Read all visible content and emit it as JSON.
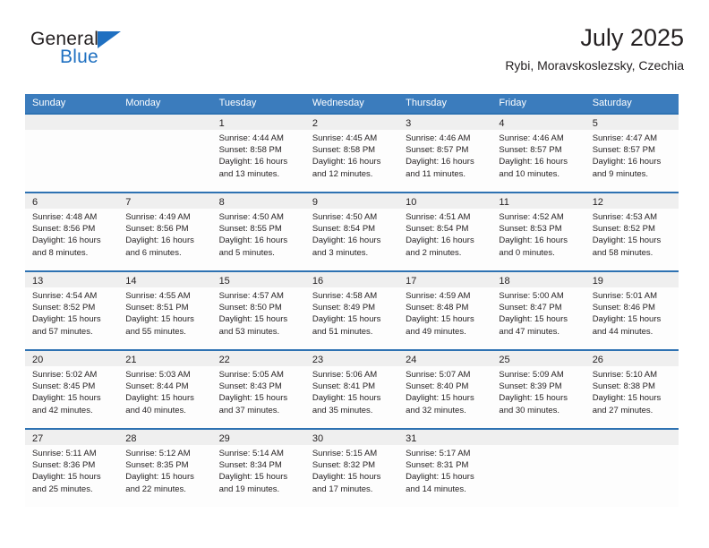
{
  "logo": {
    "line1": "General",
    "line2": "Blue",
    "accent_color": "#1F70C1",
    "text_color": "#231F20"
  },
  "header": {
    "title": "July 2025",
    "subtitle": "Rybi, Moravskoslezsky, Czechia"
  },
  "colors": {
    "header_blue": "#3B7CBD",
    "row_rule_blue": "#2E72B2",
    "day_band_gray": "#EFEFEF",
    "cell_white": "#FDFDFD"
  },
  "weekdays": [
    "Sunday",
    "Monday",
    "Tuesday",
    "Wednesday",
    "Thursday",
    "Friday",
    "Saturday"
  ],
  "weeks": [
    [
      {
        "day": "",
        "sunrise": "",
        "sunset": "",
        "daylight1": "",
        "daylight2": ""
      },
      {
        "day": "",
        "sunrise": "",
        "sunset": "",
        "daylight1": "",
        "daylight2": ""
      },
      {
        "day": "1",
        "sunrise": "Sunrise: 4:44 AM",
        "sunset": "Sunset: 8:58 PM",
        "daylight1": "Daylight: 16 hours",
        "daylight2": "and 13 minutes."
      },
      {
        "day": "2",
        "sunrise": "Sunrise: 4:45 AM",
        "sunset": "Sunset: 8:58 PM",
        "daylight1": "Daylight: 16 hours",
        "daylight2": "and 12 minutes."
      },
      {
        "day": "3",
        "sunrise": "Sunrise: 4:46 AM",
        "sunset": "Sunset: 8:57 PM",
        "daylight1": "Daylight: 16 hours",
        "daylight2": "and 11 minutes."
      },
      {
        "day": "4",
        "sunrise": "Sunrise: 4:46 AM",
        "sunset": "Sunset: 8:57 PM",
        "daylight1": "Daylight: 16 hours",
        "daylight2": "and 10 minutes."
      },
      {
        "day": "5",
        "sunrise": "Sunrise: 4:47 AM",
        "sunset": "Sunset: 8:57 PM",
        "daylight1": "Daylight: 16 hours",
        "daylight2": "and 9 minutes."
      }
    ],
    [
      {
        "day": "6",
        "sunrise": "Sunrise: 4:48 AM",
        "sunset": "Sunset: 8:56 PM",
        "daylight1": "Daylight: 16 hours",
        "daylight2": "and 8 minutes."
      },
      {
        "day": "7",
        "sunrise": "Sunrise: 4:49 AM",
        "sunset": "Sunset: 8:56 PM",
        "daylight1": "Daylight: 16 hours",
        "daylight2": "and 6 minutes."
      },
      {
        "day": "8",
        "sunrise": "Sunrise: 4:50 AM",
        "sunset": "Sunset: 8:55 PM",
        "daylight1": "Daylight: 16 hours",
        "daylight2": "and 5 minutes."
      },
      {
        "day": "9",
        "sunrise": "Sunrise: 4:50 AM",
        "sunset": "Sunset: 8:54 PM",
        "daylight1": "Daylight: 16 hours",
        "daylight2": "and 3 minutes."
      },
      {
        "day": "10",
        "sunrise": "Sunrise: 4:51 AM",
        "sunset": "Sunset: 8:54 PM",
        "daylight1": "Daylight: 16 hours",
        "daylight2": "and 2 minutes."
      },
      {
        "day": "11",
        "sunrise": "Sunrise: 4:52 AM",
        "sunset": "Sunset: 8:53 PM",
        "daylight1": "Daylight: 16 hours",
        "daylight2": "and 0 minutes."
      },
      {
        "day": "12",
        "sunrise": "Sunrise: 4:53 AM",
        "sunset": "Sunset: 8:52 PM",
        "daylight1": "Daylight: 15 hours",
        "daylight2": "and 58 minutes."
      }
    ],
    [
      {
        "day": "13",
        "sunrise": "Sunrise: 4:54 AM",
        "sunset": "Sunset: 8:52 PM",
        "daylight1": "Daylight: 15 hours",
        "daylight2": "and 57 minutes."
      },
      {
        "day": "14",
        "sunrise": "Sunrise: 4:55 AM",
        "sunset": "Sunset: 8:51 PM",
        "daylight1": "Daylight: 15 hours",
        "daylight2": "and 55 minutes."
      },
      {
        "day": "15",
        "sunrise": "Sunrise: 4:57 AM",
        "sunset": "Sunset: 8:50 PM",
        "daylight1": "Daylight: 15 hours",
        "daylight2": "and 53 minutes."
      },
      {
        "day": "16",
        "sunrise": "Sunrise: 4:58 AM",
        "sunset": "Sunset: 8:49 PM",
        "daylight1": "Daylight: 15 hours",
        "daylight2": "and 51 minutes."
      },
      {
        "day": "17",
        "sunrise": "Sunrise: 4:59 AM",
        "sunset": "Sunset: 8:48 PM",
        "daylight1": "Daylight: 15 hours",
        "daylight2": "and 49 minutes."
      },
      {
        "day": "18",
        "sunrise": "Sunrise: 5:00 AM",
        "sunset": "Sunset: 8:47 PM",
        "daylight1": "Daylight: 15 hours",
        "daylight2": "and 47 minutes."
      },
      {
        "day": "19",
        "sunrise": "Sunrise: 5:01 AM",
        "sunset": "Sunset: 8:46 PM",
        "daylight1": "Daylight: 15 hours",
        "daylight2": "and 44 minutes."
      }
    ],
    [
      {
        "day": "20",
        "sunrise": "Sunrise: 5:02 AM",
        "sunset": "Sunset: 8:45 PM",
        "daylight1": "Daylight: 15 hours",
        "daylight2": "and 42 minutes."
      },
      {
        "day": "21",
        "sunrise": "Sunrise: 5:03 AM",
        "sunset": "Sunset: 8:44 PM",
        "daylight1": "Daylight: 15 hours",
        "daylight2": "and 40 minutes."
      },
      {
        "day": "22",
        "sunrise": "Sunrise: 5:05 AM",
        "sunset": "Sunset: 8:43 PM",
        "daylight1": "Daylight: 15 hours",
        "daylight2": "and 37 minutes."
      },
      {
        "day": "23",
        "sunrise": "Sunrise: 5:06 AM",
        "sunset": "Sunset: 8:41 PM",
        "daylight1": "Daylight: 15 hours",
        "daylight2": "and 35 minutes."
      },
      {
        "day": "24",
        "sunrise": "Sunrise: 5:07 AM",
        "sunset": "Sunset: 8:40 PM",
        "daylight1": "Daylight: 15 hours",
        "daylight2": "and 32 minutes."
      },
      {
        "day": "25",
        "sunrise": "Sunrise: 5:09 AM",
        "sunset": "Sunset: 8:39 PM",
        "daylight1": "Daylight: 15 hours",
        "daylight2": "and 30 minutes."
      },
      {
        "day": "26",
        "sunrise": "Sunrise: 5:10 AM",
        "sunset": "Sunset: 8:38 PM",
        "daylight1": "Daylight: 15 hours",
        "daylight2": "and 27 minutes."
      }
    ],
    [
      {
        "day": "27",
        "sunrise": "Sunrise: 5:11 AM",
        "sunset": "Sunset: 8:36 PM",
        "daylight1": "Daylight: 15 hours",
        "daylight2": "and 25 minutes."
      },
      {
        "day": "28",
        "sunrise": "Sunrise: 5:12 AM",
        "sunset": "Sunset: 8:35 PM",
        "daylight1": "Daylight: 15 hours",
        "daylight2": "and 22 minutes."
      },
      {
        "day": "29",
        "sunrise": "Sunrise: 5:14 AM",
        "sunset": "Sunset: 8:34 PM",
        "daylight1": "Daylight: 15 hours",
        "daylight2": "and 19 minutes."
      },
      {
        "day": "30",
        "sunrise": "Sunrise: 5:15 AM",
        "sunset": "Sunset: 8:32 PM",
        "daylight1": "Daylight: 15 hours",
        "daylight2": "and 17 minutes."
      },
      {
        "day": "31",
        "sunrise": "Sunrise: 5:17 AM",
        "sunset": "Sunset: 8:31 PM",
        "daylight1": "Daylight: 15 hours",
        "daylight2": "and 14 minutes."
      },
      {
        "day": "",
        "sunrise": "",
        "sunset": "",
        "daylight1": "",
        "daylight2": ""
      },
      {
        "day": "",
        "sunrise": "",
        "sunset": "",
        "daylight1": "",
        "daylight2": ""
      }
    ]
  ]
}
